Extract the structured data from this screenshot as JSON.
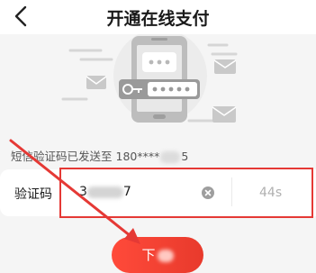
{
  "header": {
    "title": "开通在线支付",
    "back_icon": "chevron-left-icon"
  },
  "illustration": {
    "icon": "phone-password-illustration"
  },
  "sms_notice": {
    "prefix": "短信验证码已发送至",
    "phone": "180****",
    "suffix": "5"
  },
  "verification": {
    "label": "验证码",
    "value_start": "3",
    "value_end": "7",
    "clear_icon": "clear-circle-icon",
    "countdown": "44s"
  },
  "submit": {
    "label": "下"
  },
  "colors": {
    "accent": "#e83a2c",
    "annotation": "#e53935"
  }
}
